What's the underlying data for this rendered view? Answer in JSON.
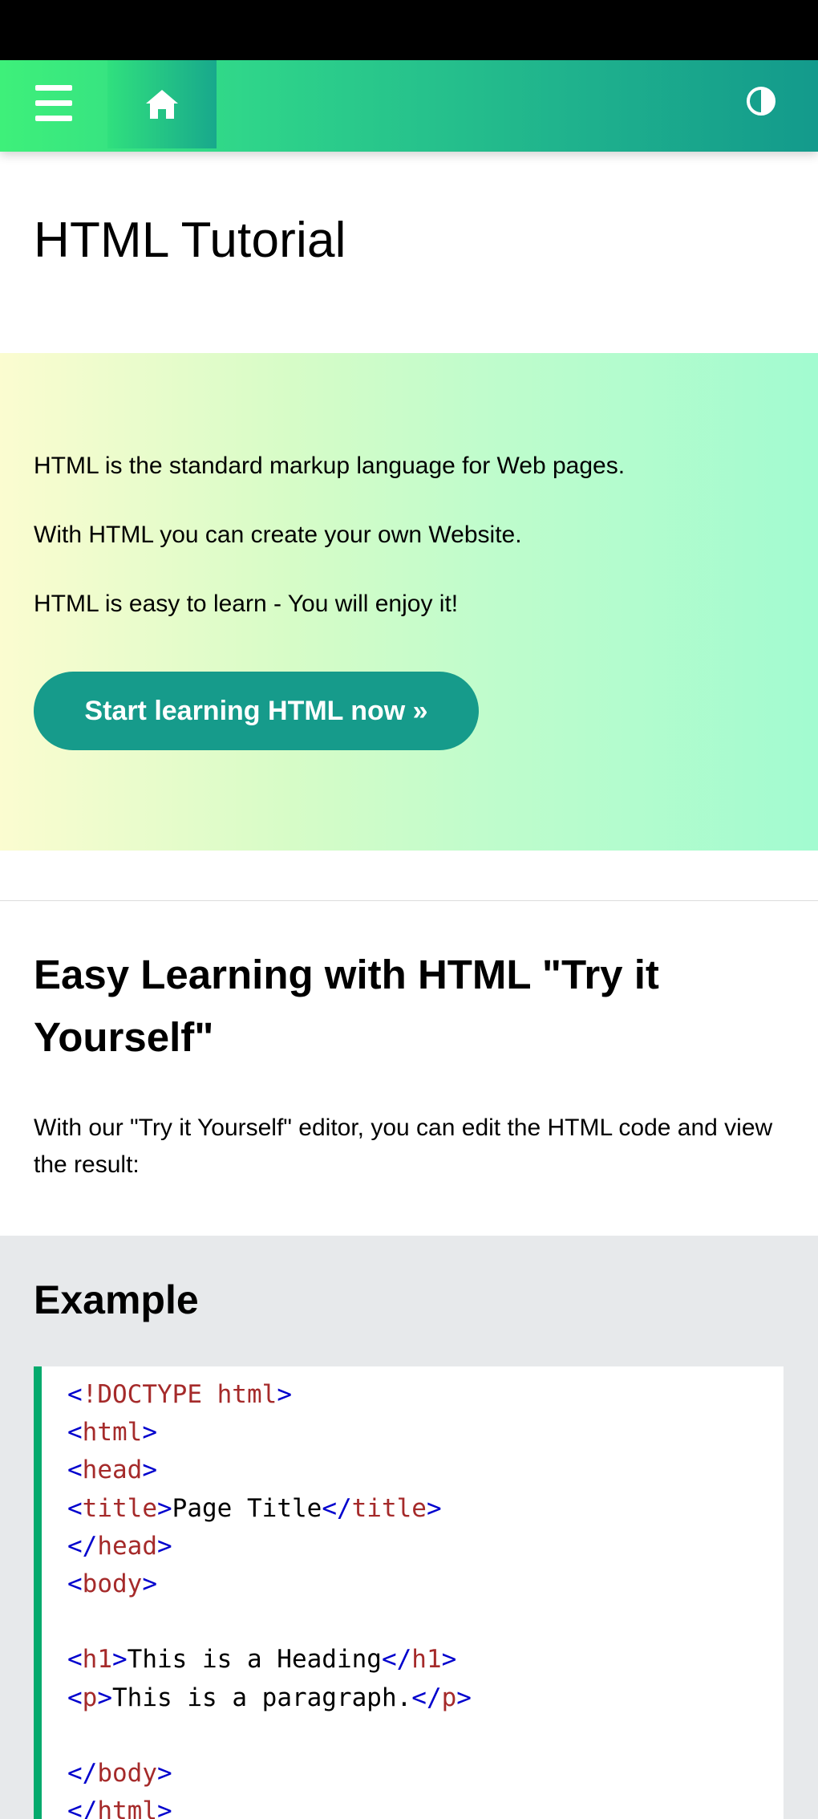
{
  "nav": {
    "menu_icon": "hamburger-menu-icon",
    "home_icon": "home-icon",
    "theme_icon": "contrast-toggle-icon",
    "gradient_start": "#3ef07a",
    "gradient_end": "#139a8c"
  },
  "page": {
    "title": "HTML Tutorial"
  },
  "hero": {
    "line1": "HTML is the standard markup language for Web pages.",
    "line2": "With HTML you can create your own Website.",
    "line3": "HTML is easy to learn - You will enjoy it!",
    "cta_label": "Start learning HTML now »",
    "cta_color": "#169b8b"
  },
  "section": {
    "title": "Easy Learning with HTML \"Try it Yourself\"",
    "text": "With our \"Try it Yourself\" editor, you can edit the HTML code and view the result:"
  },
  "example": {
    "title": "Example",
    "code_lines": [
      [
        {
          "t": "<",
          "c": "tb"
        },
        {
          "t": "!DOCTYPE html",
          "c": "tn"
        },
        {
          "t": ">",
          "c": "tb"
        }
      ],
      [
        {
          "t": "<",
          "c": "tb"
        },
        {
          "t": "html",
          "c": "tn"
        },
        {
          "t": ">",
          "c": "tb"
        }
      ],
      [
        {
          "t": "<",
          "c": "tb"
        },
        {
          "t": "head",
          "c": "tn"
        },
        {
          "t": ">",
          "c": "tb"
        }
      ],
      [
        {
          "t": "<",
          "c": "tb"
        },
        {
          "t": "title",
          "c": "tn"
        },
        {
          "t": ">",
          "c": "tb"
        },
        {
          "t": "Page Title",
          "c": ""
        },
        {
          "t": "</",
          "c": "tb"
        },
        {
          "t": "title",
          "c": "tn"
        },
        {
          "t": ">",
          "c": "tb"
        }
      ],
      [
        {
          "t": "</",
          "c": "tb"
        },
        {
          "t": "head",
          "c": "tn"
        },
        {
          "t": ">",
          "c": "tb"
        }
      ],
      [
        {
          "t": "<",
          "c": "tb"
        },
        {
          "t": "body",
          "c": "tn"
        },
        {
          "t": ">",
          "c": "tb"
        }
      ],
      [],
      [
        {
          "t": "<",
          "c": "tb"
        },
        {
          "t": "h1",
          "c": "tn"
        },
        {
          "t": ">",
          "c": "tb"
        },
        {
          "t": "This is a Heading",
          "c": ""
        },
        {
          "t": "</",
          "c": "tb"
        },
        {
          "t": "h1",
          "c": "tn"
        },
        {
          "t": ">",
          "c": "tb"
        }
      ],
      [
        {
          "t": "<",
          "c": "tb"
        },
        {
          "t": "p",
          "c": "tn"
        },
        {
          "t": ">",
          "c": "tb"
        },
        {
          "t": "This is a paragraph.",
          "c": ""
        },
        {
          "t": "</",
          "c": "tb"
        },
        {
          "t": "p",
          "c": "tn"
        },
        {
          "t": ">",
          "c": "tb"
        }
      ],
      [],
      [
        {
          "t": "</",
          "c": "tb"
        },
        {
          "t": "body",
          "c": "tn"
        },
        {
          "t": ">",
          "c": "tb"
        }
      ],
      [
        {
          "t": "</",
          "c": "tb"
        },
        {
          "t": "html",
          "c": "tn"
        },
        {
          "t": ">",
          "c": "tb"
        }
      ]
    ]
  }
}
